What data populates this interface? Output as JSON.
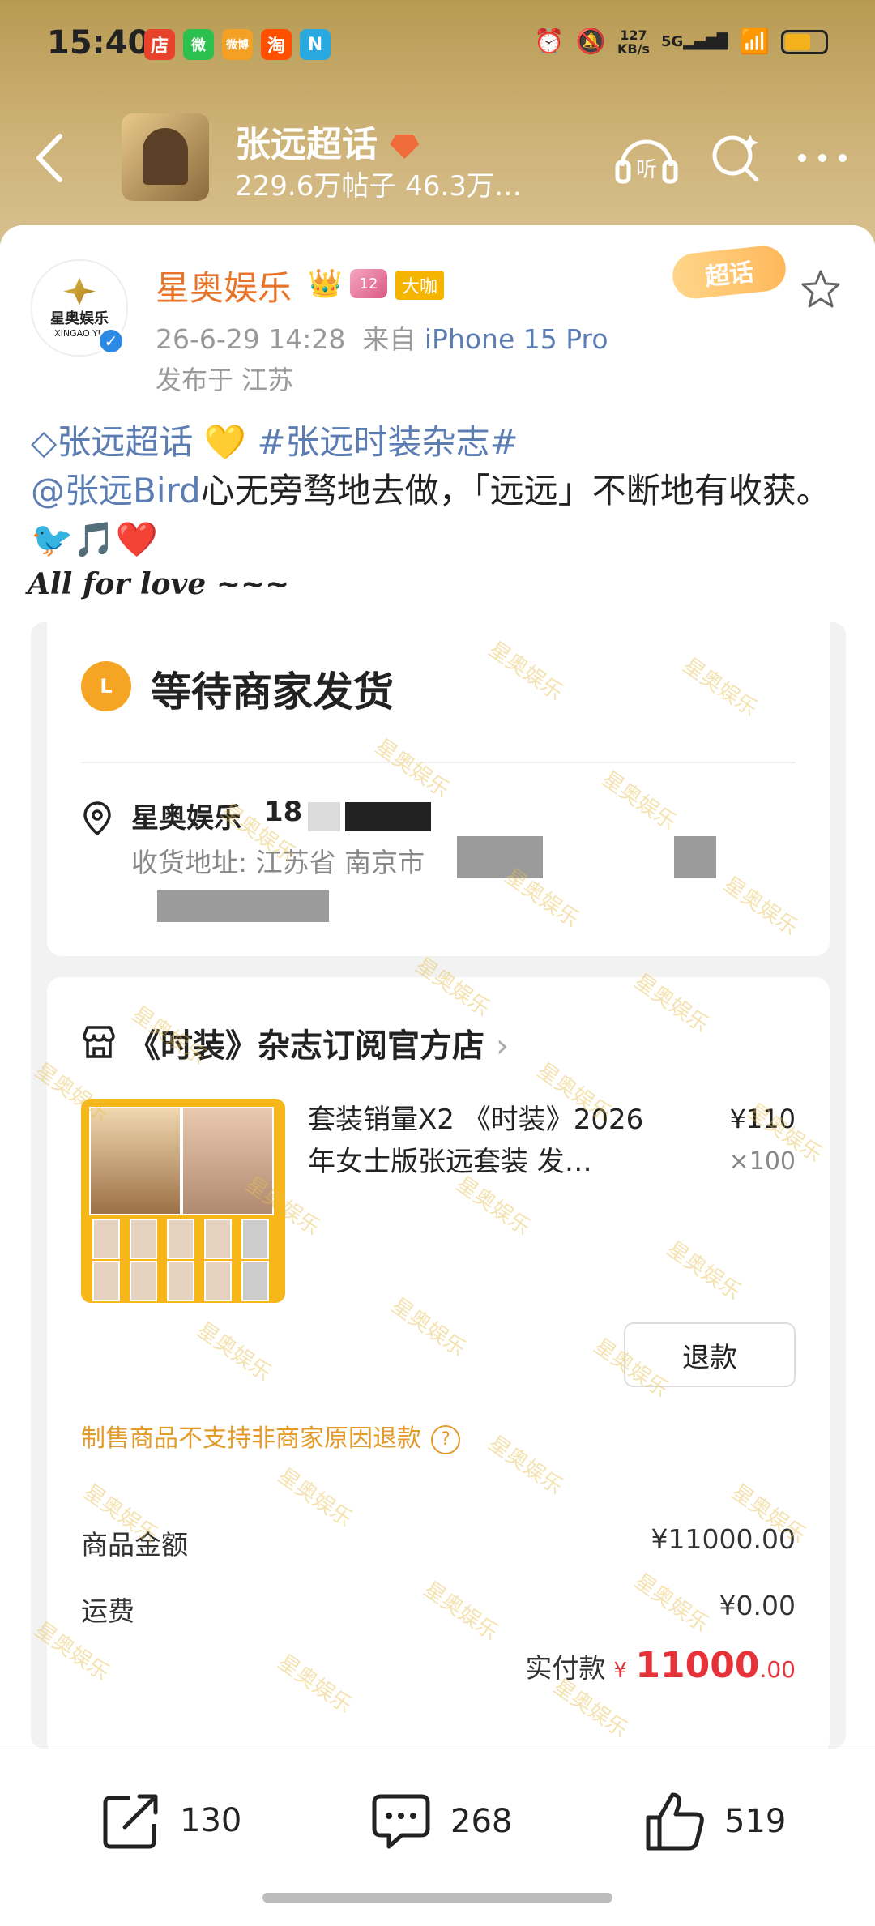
{
  "status_bar": {
    "time": "15:40",
    "net_speed_value": "127",
    "net_speed_unit": "KB/s",
    "network": "5G",
    "app_icons": [
      "店",
      "微",
      "微博",
      "淘",
      "N"
    ]
  },
  "topbar": {
    "title": "张远超话",
    "subtitle": "229.6万帖子 46.3万…",
    "listen_label": "听"
  },
  "post": {
    "author": "星奥娱乐",
    "author_badge": "大咖",
    "vip_level": "12",
    "avatar_text": "星奥娱乐",
    "avatar_subtext": "XINGAO YU",
    "date": "26-6-29 14:28",
    "from_prefix": "来自",
    "device": "iPhone 15 Pro",
    "location": "发布于 江苏",
    "chaohua_badge": "超话",
    "topic_link": "张远超话",
    "hashtag": "#张远时装杂志#",
    "mention": "@张远Bird",
    "body": "心无旁骛地去做，「远远」不断地有收获。",
    "emojis": "🐦🎵❤️",
    "love_line": "All for love ~~~"
  },
  "order": {
    "status": "等待商家发货",
    "status_icon_letter": "L",
    "recipient": "星奥娱乐",
    "phone_prefix": "18",
    "address": "收货地址: 江苏省 南京市",
    "store_name": "《时装》杂志订阅官方店",
    "product_title": "套装销量X2 《时装》2026年女士版张远套装 发…",
    "price": "¥110",
    "quantity": "×100",
    "refund_label": "退款",
    "notice": "制售商品不支持非商家原因退款",
    "goods_amount_label": "商品金额",
    "goods_amount": "¥11000.00",
    "shipping_label": "运费",
    "shipping": "¥0.00",
    "paid_label": "实付款",
    "paid_currency": "¥",
    "paid_integer": "11000",
    "paid_decimal": ".00",
    "watermark": "星奥娱乐"
  },
  "actions": {
    "share_count": "130",
    "comment_count": "268",
    "like_count": "519"
  },
  "colors": {
    "accent_orange": "#e8742a",
    "link_blue": "#5b7db3",
    "price_red": "#e8323a",
    "status_yellow": "#f5a523"
  }
}
